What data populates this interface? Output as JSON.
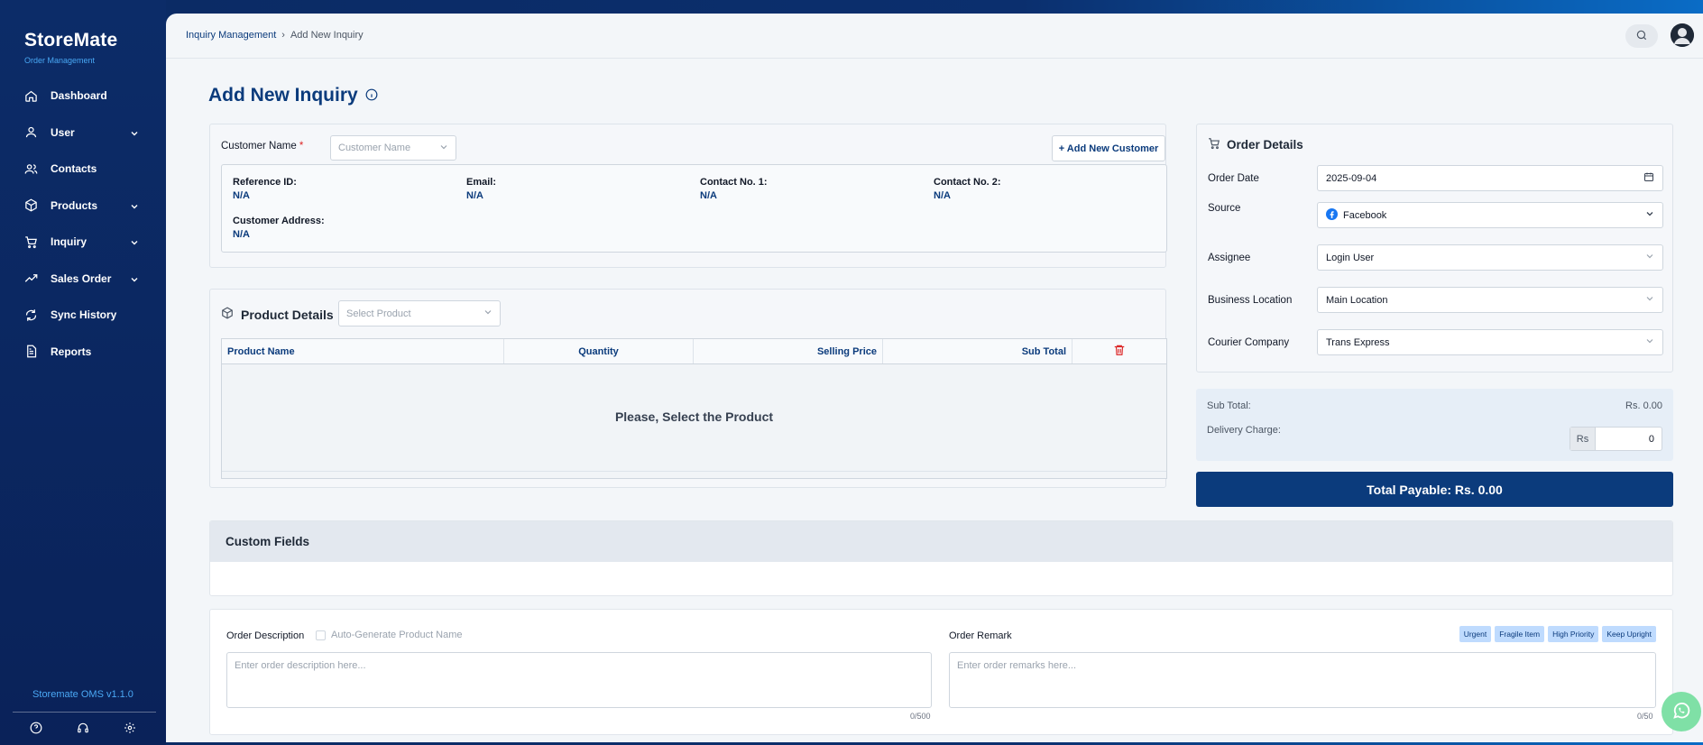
{
  "brand": {
    "name": "StoreMate",
    "subtitle": "Order Management",
    "version": "Storemate OMS v1.1.0"
  },
  "sidebar": {
    "items": [
      {
        "label": "Dashboard",
        "icon": "home-icon",
        "expandable": false
      },
      {
        "label": "User",
        "icon": "user-icon",
        "expandable": true
      },
      {
        "label": "Contacts",
        "icon": "users-icon",
        "expandable": false
      },
      {
        "label": "Products",
        "icon": "box-icon",
        "expandable": true
      },
      {
        "label": "Inquiry",
        "icon": "cart-icon",
        "expandable": true
      },
      {
        "label": "Sales Order",
        "icon": "trend-icon",
        "expandable": true
      },
      {
        "label": "Sync History",
        "icon": "sync-icon",
        "expandable": false
      },
      {
        "label": "Reports",
        "icon": "report-icon",
        "expandable": false
      }
    ],
    "bottom_icons": [
      "help-icon",
      "headset-icon",
      "settings-icon"
    ]
  },
  "breadcrumb": {
    "parent": "Inquiry Management",
    "separator": "›",
    "current": "Add New Inquiry"
  },
  "page": {
    "title": "Add New Inquiry"
  },
  "customer": {
    "label": "Customer Name",
    "required_mark": "*",
    "placeholder": "Customer Name",
    "add_button": "+ Add New Customer",
    "fields": {
      "reference_id": {
        "label": "Reference ID:",
        "value": "N/A"
      },
      "email": {
        "label": "Email:",
        "value": "N/A"
      },
      "contact1": {
        "label": "Contact No. 1:",
        "value": "N/A"
      },
      "contact2": {
        "label": "Contact No. 2:",
        "value": "N/A"
      },
      "address": {
        "label": "Customer Address:",
        "value": "N/A"
      }
    }
  },
  "products": {
    "title": "Product Details",
    "select_placeholder": "Select Product",
    "columns": [
      "Product Name",
      "Quantity",
      "Selling Price",
      "Sub Total"
    ],
    "empty_message": "Please, Select the Product"
  },
  "order": {
    "title": "Order Details",
    "order_date": {
      "label": "Order Date",
      "value": "2025-09-04"
    },
    "source": {
      "label": "Source",
      "value": "Facebook"
    },
    "assignee": {
      "label": "Assignee",
      "value": "Login User"
    },
    "business_location": {
      "label": "Business Location",
      "value": "Main Location"
    },
    "courier": {
      "label": "Courier Company",
      "value": "Trans Express"
    }
  },
  "summary": {
    "subtotal_label": "Sub Total:",
    "subtotal_value": "Rs. 0.00",
    "delivery_label": "Delivery Charge:",
    "delivery_prefix": "Rs",
    "delivery_value": "0",
    "total": "Total Payable: Rs. 0.00"
  },
  "custom_fields": {
    "title": "Custom Fields"
  },
  "description": {
    "label": "Order Description",
    "autogen_label": "Auto-Generate Product Name",
    "placeholder": "Enter order description here...",
    "counter": "0/500"
  },
  "remark": {
    "label": "Order Remark",
    "placeholder": "Enter order remarks here...",
    "counter": "0/50",
    "tags": [
      "Urgent",
      "Fragile Item",
      "High Priority",
      "Keep Upright"
    ]
  },
  "colors": {
    "primary": "#0b3b7c",
    "accent": "#49a8f5",
    "danger": "#dc2626",
    "sidebar": "#0c2c68"
  }
}
